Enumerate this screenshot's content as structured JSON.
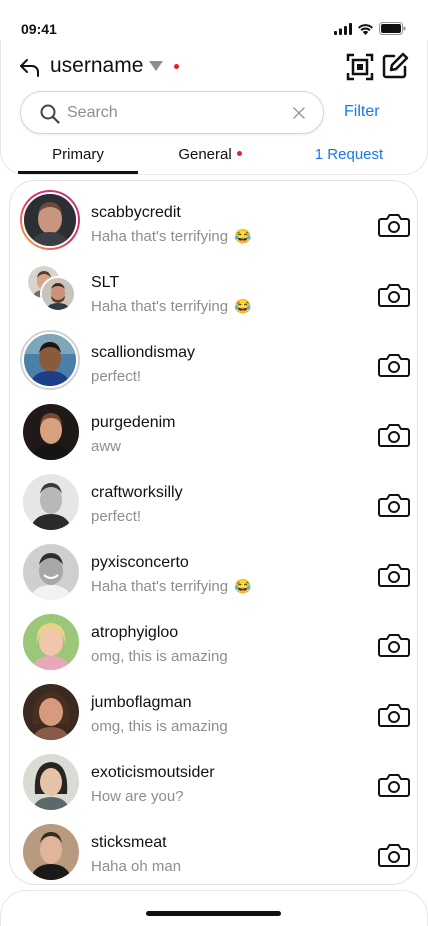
{
  "status_bar": {
    "time": "09:41"
  },
  "header": {
    "username": "username"
  },
  "search": {
    "placeholder": "Search",
    "value": "",
    "filter_label": "Filter"
  },
  "tabs": {
    "primary": "Primary",
    "general": "General",
    "request": "1 Request"
  },
  "colors": {
    "accent": "#1877f2",
    "notification": "#ed1c24",
    "secondary_text": "#8e8e8e"
  },
  "chats": [
    {
      "name": "scabbycredit",
      "message": "Haha that's terrifying",
      "emoji": "😂",
      "avatar": "avatar-scabbycredit",
      "ring": "story"
    },
    {
      "name": "SLT",
      "message": "Haha that's terrifying",
      "emoji": "😂",
      "avatar": "group-avatar",
      "ring": "none"
    },
    {
      "name": "scalliondismay",
      "message": "perfect!",
      "emoji": "",
      "avatar": "avatar-scalliondismay",
      "ring": "seen"
    },
    {
      "name": "purgedenim",
      "message": "aww",
      "emoji": "",
      "avatar": "avatar-purgedenim",
      "ring": "none"
    },
    {
      "name": "craftworksilly",
      "message": "perfect!",
      "emoji": "",
      "avatar": "avatar-craftworksilly",
      "ring": "none"
    },
    {
      "name": "pyxisconcerto",
      "message": "Haha that's terrifying",
      "emoji": "😂",
      "avatar": "avatar-pyxisconcerto",
      "ring": "none"
    },
    {
      "name": "atrophyigloo",
      "message": "omg, this is amazing",
      "emoji": "",
      "avatar": "avatar-atrophyigloo",
      "ring": "none"
    },
    {
      "name": "jumboflagman",
      "message": "omg, this is amazing",
      "emoji": "",
      "avatar": "avatar-jumboflagman",
      "ring": "none"
    },
    {
      "name": "exoticismoutsider",
      "message": "How are you?",
      "emoji": "",
      "avatar": "avatar-exoticismoutsider",
      "ring": "none"
    },
    {
      "name": "sticksmeat",
      "message": "Haha oh man",
      "emoji": "",
      "avatar": "avatar-sticksmeat",
      "ring": "none"
    }
  ]
}
